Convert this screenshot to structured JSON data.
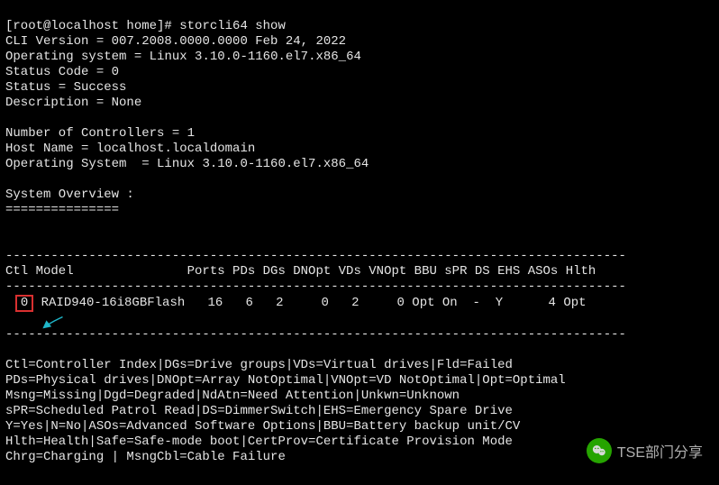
{
  "prompt": "[root@localhost home]# ",
  "command": "storcli64 show",
  "header": {
    "cli_version_label": "CLI Version = ",
    "cli_version_value": "007.2008.0000.0000 Feb 24, 2022",
    "os_label": "Operating system = ",
    "os_value": "Linux 3.10.0-1160.el7.x86_64",
    "status_code_label": "Status Code = ",
    "status_code_value": "0",
    "status_label": "Status = ",
    "status_value": "Success",
    "description_label": "Description = ",
    "description_value": "None"
  },
  "info": {
    "controllers_label": "Number of Controllers = ",
    "controllers_value": "1",
    "host_label": "Host Name = ",
    "host_value": "localhost.localdomain",
    "os2_label": "Operating System  = ",
    "os2_value": "Linux 3.10.0-1160.el7.x86_64"
  },
  "overview_title": "System Overview :",
  "overview_underline": "===============",
  "table": {
    "sep": "----------------------------------------------------------------------------------",
    "header": "Ctl Model               Ports PDs DGs DNOpt VDs VNOpt BBU sPR DS EHS ASOs Hlth",
    "row": {
      "ctl": "0",
      "rest": " RAID940-16i8GBFlash   16   6   2     0   2     0 Opt On  -  Y      4 Opt"
    }
  },
  "legend": [
    "Ctl=Controller Index|DGs=Drive groups|VDs=Virtual drives|Fld=Failed",
    "PDs=Physical drives|DNOpt=Array NotOptimal|VNOpt=VD NotOptimal|Opt=Optimal",
    "Msng=Missing|Dgd=Degraded|NdAtn=Need Attention|Unkwn=Unknown",
    "sPR=Scheduled Patrol Read|DS=DimmerSwitch|EHS=Emergency Spare Drive",
    "Y=Yes|N=No|ASOs=Advanced Software Options|BBU=Battery backup unit/CV",
    "Hlth=Health|Safe=Safe-mode boot|CertProv=Certificate Provision Mode",
    "Chrg=Charging | MsngCbl=Cable Failure"
  ],
  "watermark_text": "TSE部门分享",
  "chart_data": {
    "type": "table",
    "columns": [
      "Ctl",
      "Model",
      "Ports",
      "PDs",
      "DGs",
      "DNOpt",
      "VDs",
      "VNOpt",
      "BBU",
      "sPR",
      "DS",
      "EHS",
      "ASOs",
      "Hlth"
    ],
    "rows": [
      [
        "0",
        "RAID940-16i8GBFlash",
        "16",
        "6",
        "2",
        "0",
        "2",
        "0",
        "Opt",
        "On",
        "-",
        "Y",
        "4",
        "Opt"
      ]
    ]
  }
}
